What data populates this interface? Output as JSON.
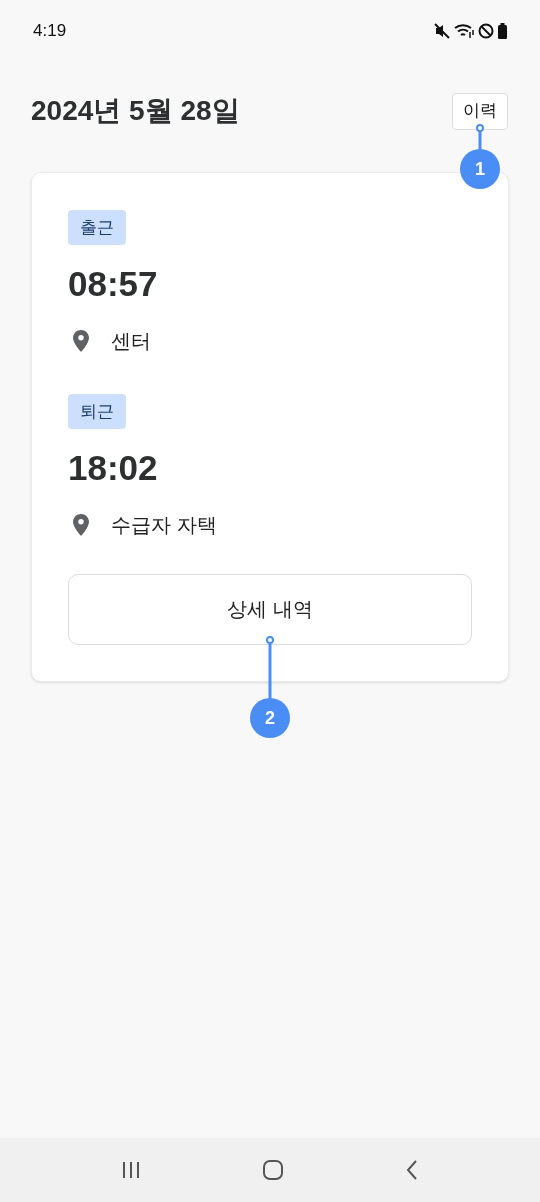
{
  "status_bar": {
    "time": "4:19"
  },
  "header": {
    "title": "2024년 5월 28일",
    "history_button": "이력"
  },
  "records": [
    {
      "label": "출근",
      "time": "08:57",
      "location": "센터"
    },
    {
      "label": "퇴근",
      "time": "18:02",
      "location": "수급자 자택"
    }
  ],
  "detail_button": "상세 내역",
  "annotations": [
    "1",
    "2"
  ]
}
